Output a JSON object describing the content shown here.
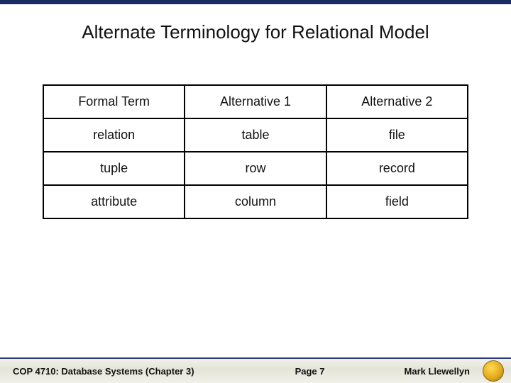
{
  "title": "Alternate Terminology for Relational Model",
  "table": {
    "headers": [
      "Formal Term",
      "Alternative 1",
      "Alternative 2"
    ],
    "rows": [
      [
        "relation",
        "table",
        "file"
      ],
      [
        "tuple",
        "row",
        "record"
      ],
      [
        "attribute",
        "column",
        "field"
      ]
    ]
  },
  "footer": {
    "course": "COP 4710: Database Systems  (Chapter 3)",
    "page": "Page 7",
    "author": "Mark Llewellyn"
  }
}
